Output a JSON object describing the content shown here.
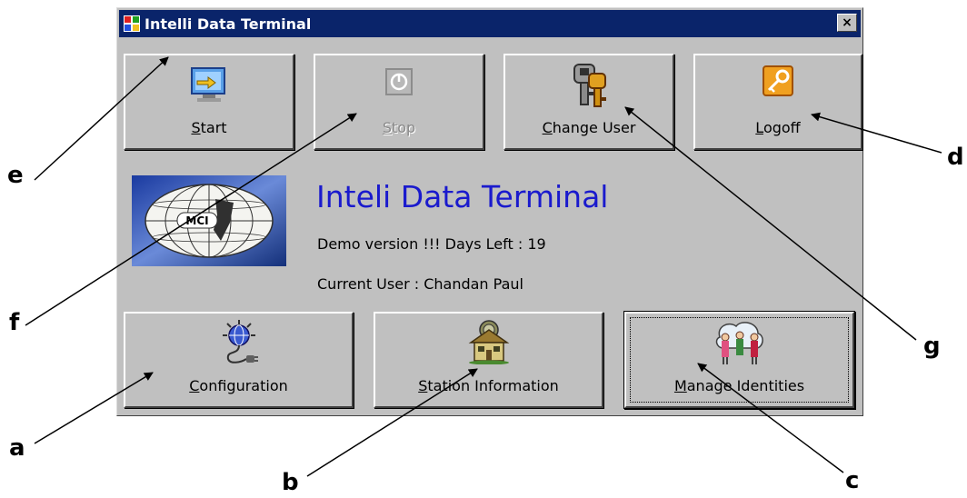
{
  "window": {
    "title": "Intelli Data Terminal",
    "close_symbol": "×"
  },
  "toolbar": {
    "start": {
      "accel": "S",
      "rest": "tart",
      "icon": "start-icon"
    },
    "stop": {
      "accel": "S",
      "rest": "top",
      "icon": "stop-icon",
      "disabled": true
    },
    "change_user": {
      "accel": "C",
      "rest": "hange User",
      "icon": "keys-icon"
    },
    "logoff": {
      "accel": "L",
      "rest": "ogoff",
      "icon": "key-icon"
    }
  },
  "info": {
    "heading": "Inteli Data Terminal",
    "demo_line": "Demo version !!! Days Left : 19",
    "user_line": "Current User : Chandan Paul",
    "logo_text": "MCI"
  },
  "bottom_buttons": {
    "configuration": {
      "accel": "C",
      "rest": "onfiguration",
      "icon": "globe-plug-icon"
    },
    "station_information": {
      "accel": "S",
      "rest": "tation Information",
      "icon": "house-icon"
    },
    "manage_identities": {
      "accel": "M",
      "rest": "anage Identities",
      "icon": "people-icon"
    }
  },
  "callouts": {
    "a": "a",
    "b": "b",
    "c": "c",
    "d": "d",
    "e": "e",
    "f": "f",
    "g": "g"
  }
}
